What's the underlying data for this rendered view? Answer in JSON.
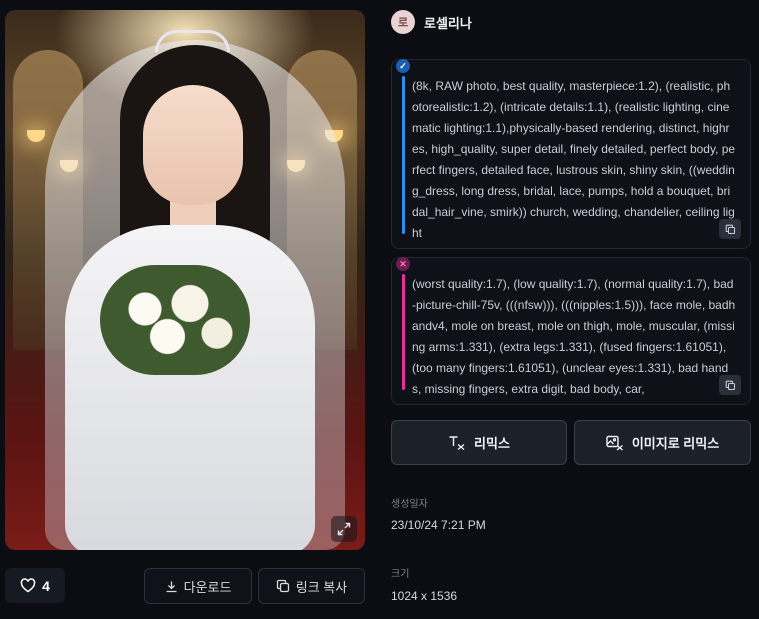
{
  "author": {
    "avatar_initial": "로",
    "name": "로셀리나"
  },
  "prompt": {
    "positive_badge": "✓",
    "positive": "(8k, RAW photo, best quality, masterpiece:1.2), (realistic, photorealistic:1.2), (intricate details:1.1), (realistic lighting, cinematic lighting:1.1),physically-based rendering, distinct, highres, high_quality, super detail, finely detailed, perfect body, perfect fingers, detailed face, lustrous skin, shiny skin, ((wedding_dress, long dress, bridal, lace, pumps, hold a bouquet, bridal_hair_vine, smirk)) church, wedding, chandelier, ceiling light",
    "negative_badge": "✕",
    "negative": "(worst quality:1.7), (low quality:1.7), (normal quality:1.7), bad-picture-chill-75v, (((nfsw))), (((nipples:1.5))), face mole, badhandv4, mole on breast, mole on thigh, mole, muscular, (missing arms:1.331), (extra legs:1.331), (fused fingers:1.61051), (too many fingers:1.61051), (unclear eyes:1.331), bad hands, missing fingers, extra digit, bad body, car,"
  },
  "actions": {
    "remix": "리믹스",
    "image_remix": "이미지로 리믹스"
  },
  "meta": {
    "created_label": "생성일자",
    "created_value": "23/10/24 7:21 PM",
    "size_label": "크기",
    "size_value": "1024 x 1536"
  },
  "footer": {
    "like_count": "4",
    "download": "다운로드",
    "copy_link": "링크 복사"
  },
  "colors": {
    "positive_accent": "#2f8fe8",
    "negative_accent": "#e8309a",
    "background": "#0b0d12"
  }
}
